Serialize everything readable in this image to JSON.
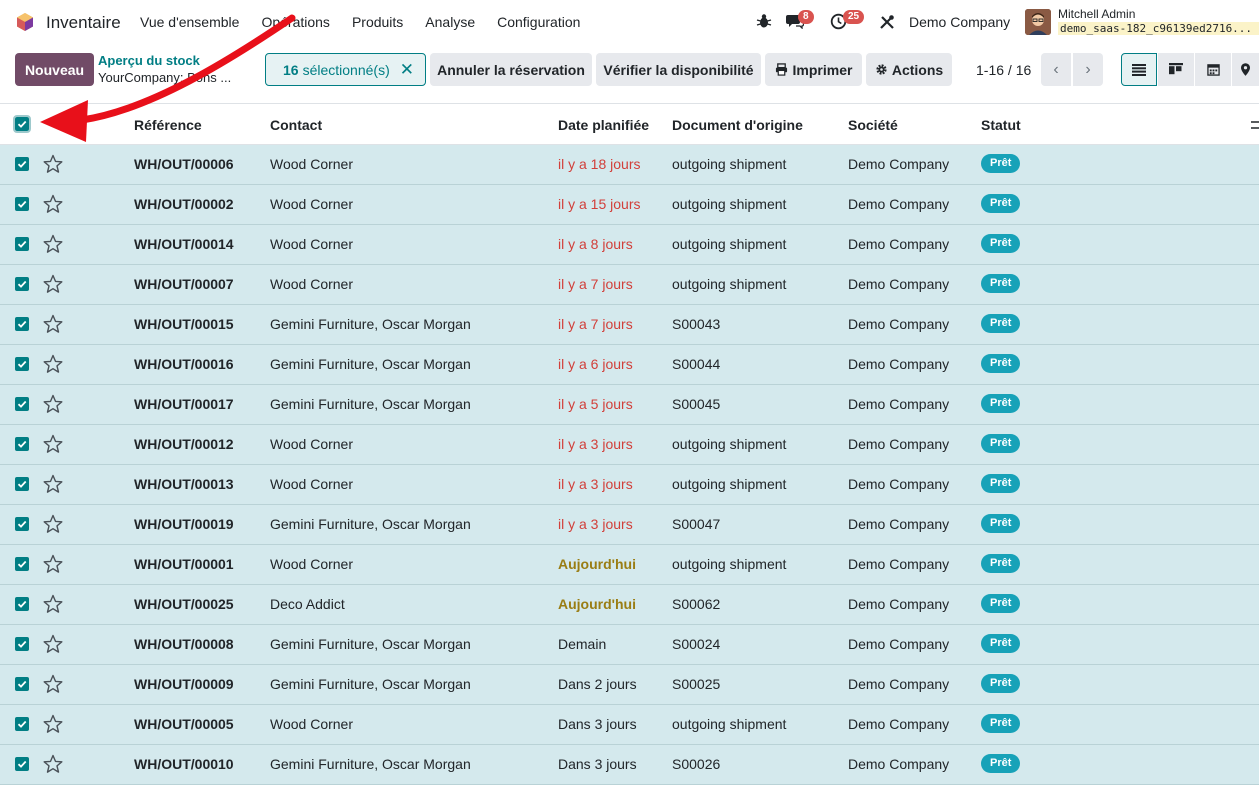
{
  "navbar": {
    "app_name": "Inventaire",
    "menu": [
      "Vue d'ensemble",
      "Opérations",
      "Produits",
      "Analyse",
      "Configuration"
    ],
    "messages_badge": "8",
    "activities_badge": "25",
    "company": "Demo Company",
    "user_name": "Mitchell Admin",
    "db_name": "demo_saas-182_c96139ed2716..."
  },
  "control_panel": {
    "new_label": "Nouveau",
    "breadcrumb_parent": "Aperçu du stock",
    "breadcrumb_current": "YourCompany: Bons ...",
    "selected_count": "16",
    "selected_label": "sélectionné(s)",
    "cancel_reservation": "Annuler la réservation",
    "check_availability": "Vérifier la disponibilité",
    "print": "Imprimer",
    "actions": "Actions",
    "pager": "1-16 / 16"
  },
  "table": {
    "headers": {
      "reference": "Référence",
      "contact": "Contact",
      "date": "Date planifiée",
      "origin": "Document d'origine",
      "company": "Société",
      "status": "Statut"
    },
    "rows": [
      {
        "ref": "WH/OUT/00006",
        "contact": "Wood Corner",
        "date": "il y a 18 jours",
        "date_state": "late",
        "origin": "outgoing shipment",
        "company": "Demo Company",
        "status": "Prêt"
      },
      {
        "ref": "WH/OUT/00002",
        "contact": "Wood Corner",
        "date": "il y a 15 jours",
        "date_state": "late",
        "origin": "outgoing shipment",
        "company": "Demo Company",
        "status": "Prêt"
      },
      {
        "ref": "WH/OUT/00014",
        "contact": "Wood Corner",
        "date": "il y a 8 jours",
        "date_state": "late",
        "origin": "outgoing shipment",
        "company": "Demo Company",
        "status": "Prêt"
      },
      {
        "ref": "WH/OUT/00007",
        "contact": "Wood Corner",
        "date": "il y a 7 jours",
        "date_state": "late",
        "origin": "outgoing shipment",
        "company": "Demo Company",
        "status": "Prêt"
      },
      {
        "ref": "WH/OUT/00015",
        "contact": "Gemini Furniture, Oscar Morgan",
        "date": "il y a 7 jours",
        "date_state": "late",
        "origin": "S00043",
        "company": "Demo Company",
        "status": "Prêt"
      },
      {
        "ref": "WH/OUT/00016",
        "contact": "Gemini Furniture, Oscar Morgan",
        "date": "il y a 6 jours",
        "date_state": "late",
        "origin": "S00044",
        "company": "Demo Company",
        "status": "Prêt"
      },
      {
        "ref": "WH/OUT/00017",
        "contact": "Gemini Furniture, Oscar Morgan",
        "date": "il y a 5 jours",
        "date_state": "late",
        "origin": "S00045",
        "company": "Demo Company",
        "status": "Prêt"
      },
      {
        "ref": "WH/OUT/00012",
        "contact": "Wood Corner",
        "date": "il y a 3 jours",
        "date_state": "late",
        "origin": "outgoing shipment",
        "company": "Demo Company",
        "status": "Prêt"
      },
      {
        "ref": "WH/OUT/00013",
        "contact": "Wood Corner",
        "date": "il y a 3 jours",
        "date_state": "late",
        "origin": "outgoing shipment",
        "company": "Demo Company",
        "status": "Prêt"
      },
      {
        "ref": "WH/OUT/00019",
        "contact": "Gemini Furniture, Oscar Morgan",
        "date": "il y a 3 jours",
        "date_state": "late",
        "origin": "S00047",
        "company": "Demo Company",
        "status": "Prêt"
      },
      {
        "ref": "WH/OUT/00001",
        "contact": "Wood Corner",
        "date": "Aujourd'hui",
        "date_state": "today",
        "origin": "outgoing shipment",
        "company": "Demo Company",
        "status": "Prêt"
      },
      {
        "ref": "WH/OUT/00025",
        "contact": "Deco Addict",
        "date": "Aujourd'hui",
        "date_state": "today",
        "origin": "S00062",
        "company": "Demo Company",
        "status": "Prêt"
      },
      {
        "ref": "WH/OUT/00008",
        "contact": "Gemini Furniture, Oscar Morgan",
        "date": "Demain",
        "date_state": "future",
        "origin": "S00024",
        "company": "Demo Company",
        "status": "Prêt"
      },
      {
        "ref": "WH/OUT/00009",
        "contact": "Gemini Furniture, Oscar Morgan",
        "date": "Dans 2 jours",
        "date_state": "future",
        "origin": "S00025",
        "company": "Demo Company",
        "status": "Prêt"
      },
      {
        "ref": "WH/OUT/00005",
        "contact": "Wood Corner",
        "date": "Dans 3 jours",
        "date_state": "future",
        "origin": "outgoing shipment",
        "company": "Demo Company",
        "status": "Prêt"
      },
      {
        "ref": "WH/OUT/00010",
        "contact": "Gemini Furniture, Oscar Morgan",
        "date": "Dans 3 jours",
        "date_state": "future",
        "origin": "S00026",
        "company": "Demo Company",
        "status": "Prêt"
      }
    ]
  },
  "colors": {
    "brand": "#714b67",
    "accent": "#017e84",
    "late": "#d23f3a",
    "today": "#9a7d13",
    "status_badge": "#17a2b8",
    "selected_row": "#d4e9ed",
    "annotation_arrow": "#e8101a"
  }
}
